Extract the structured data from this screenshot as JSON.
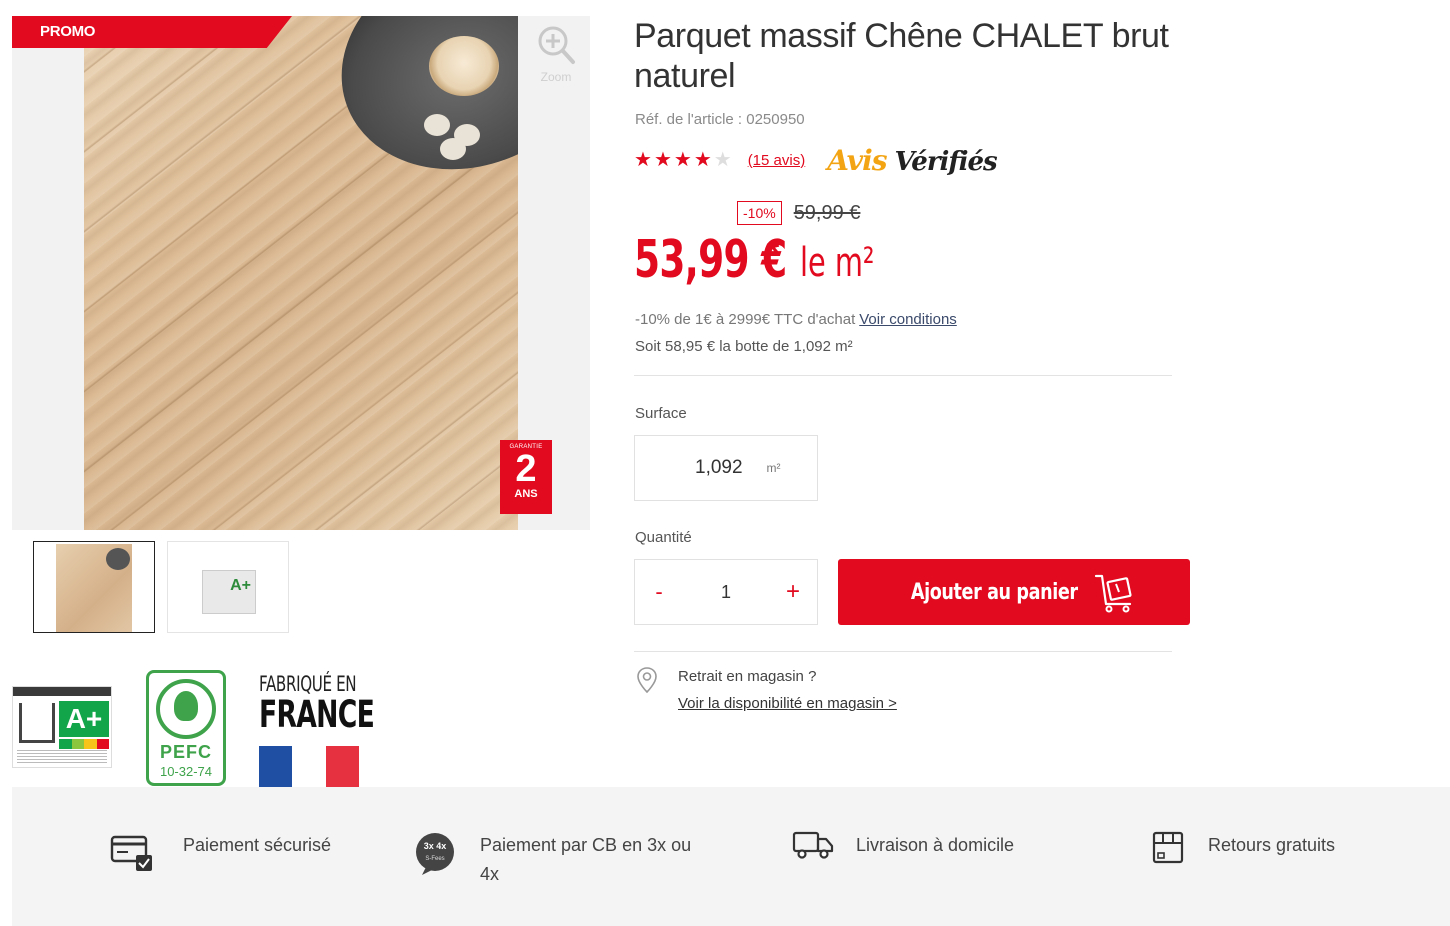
{
  "gallery": {
    "promo_badge": "PROMO",
    "zoom_label": "Zoom",
    "guarantee": {
      "top": "GARANTIE",
      "number": "2",
      "unit": "ANS"
    },
    "thumbnails": [
      {
        "label": "product-photo"
      },
      {
        "label": "A+"
      }
    ]
  },
  "certifications": {
    "air_grade": "A+",
    "pefc_name": "PEFC",
    "pefc_code": "10-32-74",
    "france_line1": "FABRIQUÉ EN",
    "france_line2": "FRANCE"
  },
  "product": {
    "title": "Parquet massif Chêne CHALET brut naturel",
    "reference": "Réf. de l'article : 0250950",
    "rating": {
      "stars_filled": 4,
      "stars_total": 5,
      "reviews_link": "(15 avis)"
    },
    "avis_logo": {
      "part1": "Avis",
      "part2": "Vérifiés"
    },
    "discount_tag": "-10%",
    "old_price": "59,99 €",
    "price": "53,99 €",
    "price_asterisk": "*",
    "price_unit": "le m²",
    "promo_text": "-10% de 1€ à 2999€ TTC d'achat",
    "promo_link": "Voir conditions",
    "bundle_text": "Soit 58,95 € la botte de 1,092 m²"
  },
  "form": {
    "surface_label": "Surface",
    "surface_value": "1,092",
    "surface_unit": "m²",
    "quantity_label": "Quantité",
    "quantity_minus": "-",
    "quantity_value": "1",
    "quantity_plus": "+",
    "add_to_cart": "Ajouter au panier"
  },
  "store": {
    "question": "Retrait en magasin ?",
    "link": "Voir la disponibilité en magasin >"
  },
  "reassurance": [
    {
      "icon": "card-payment-icon",
      "text": "Paiement sécurisé"
    },
    {
      "icon": "installments-icon",
      "text_line1": "Paiement par CB en 3x ou",
      "text_line2": "4x"
    },
    {
      "icon": "delivery-truck-icon",
      "text": "Livraison à domicile"
    },
    {
      "icon": "returns-box-icon",
      "text": "Retours gratuits"
    }
  ],
  "colors": {
    "brand_red": "#e10a1f",
    "pefc_green": "#3ea34a",
    "avis_orange": "#f2a413",
    "band_gray": "#f4f4f4"
  }
}
